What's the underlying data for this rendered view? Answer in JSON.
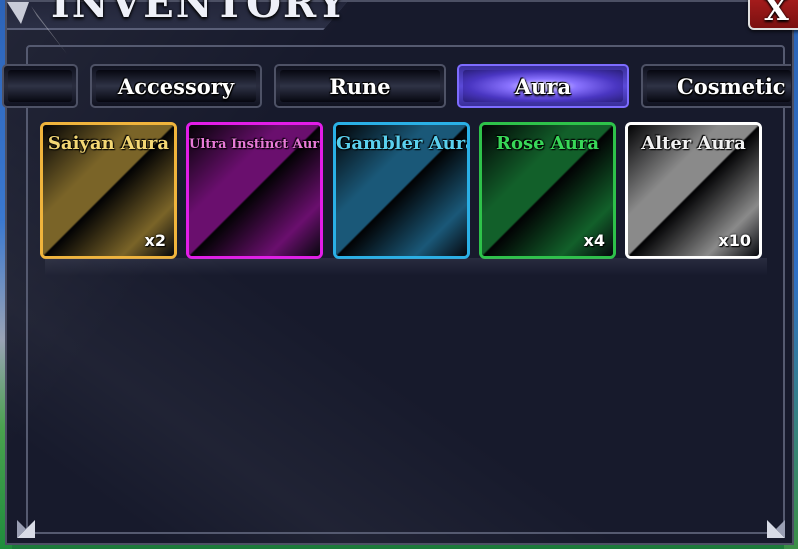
{
  "window": {
    "title": "INVENTORY",
    "close_label": "X"
  },
  "tabs": [
    {
      "label": "",
      "active": false
    },
    {
      "label": "Accessory",
      "active": false
    },
    {
      "label": "Rune",
      "active": false
    },
    {
      "label": "Aura",
      "active": true
    },
    {
      "label": "Cosmetic",
      "active": false
    }
  ],
  "items": [
    {
      "name": "Saiyan Aura",
      "quantity": "x2",
      "border_color": "#f0b43c",
      "name_color": "#f3d774",
      "tint": "#7a6428"
    },
    {
      "name": "Ultra Instinct Aura",
      "quantity": "",
      "border_color": "#e21de8",
      "name_color": "#e87ad8",
      "tint": "#6a0f6e"
    },
    {
      "name": "Gambler Aura",
      "quantity": "",
      "border_color": "#2ab0e6",
      "name_color": "#5ad0ee",
      "tint": "#1a5878"
    },
    {
      "name": "Rose Aura",
      "quantity": "x4",
      "border_color": "#2ec24a",
      "name_color": "#38d858",
      "tint": "#12602a"
    },
    {
      "name": "Alter Aura",
      "quantity": "x10",
      "border_color": "#ffffff",
      "name_color": "#f2f2f2",
      "tint": "#8a8a8a"
    }
  ]
}
